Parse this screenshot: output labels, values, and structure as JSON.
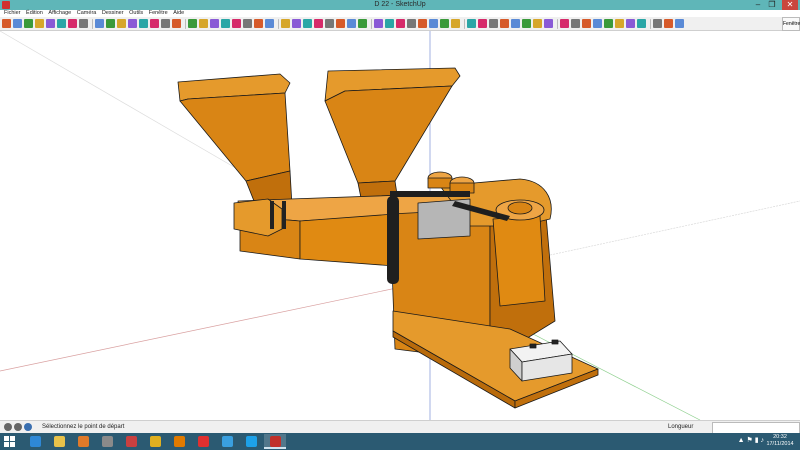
{
  "window": {
    "title": "D 22 - SketchUp"
  },
  "menu": {
    "items": [
      "Fichier",
      "Édition",
      "Affichage",
      "Caméra",
      "Dessiner",
      "Outils",
      "Fenêtre",
      "Aide"
    ]
  },
  "toolbar": {
    "dropdown_label": "Fenêtre",
    "icon_count": 66
  },
  "status": {
    "message": "Sélectionnez le point de départ",
    "measure_label": "Longueur",
    "measure_value": ""
  },
  "clock": {
    "time": "20:32",
    "date": "17/11/2014"
  },
  "taskbar": {
    "apps": [
      "ie-icon",
      "explorer-icon",
      "media-player-icon",
      "store-icon",
      "snipping-icon",
      "chrome-icon",
      "vlc-icon",
      "youtube-icon",
      "paint-icon",
      "skype-icon",
      "sketchup-icon"
    ]
  },
  "colors": {
    "model_orange": "#e08a12",
    "titlebar": "#5fb6b8",
    "taskbar": "#2b5a72"
  }
}
